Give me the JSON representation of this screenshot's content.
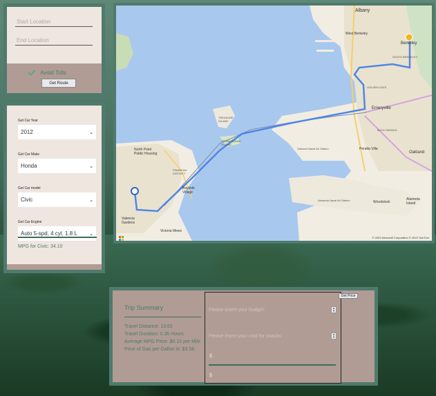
{
  "route": {
    "start_placeholder": "Start Location",
    "end_placeholder": "End Location",
    "avoid_tolls_label": "Avoid Tolls",
    "avoid_tolls_checked": true,
    "get_route_label": "Get Route"
  },
  "car": {
    "year_label": "Get Car Year",
    "year_value": "2012",
    "make_label": "Get Car Make",
    "make_value": "Honda",
    "model_label": "Get Car model",
    "model_value": "Civic",
    "engine_label": "Get Car Engine",
    "engine_value": "Auto 5-spd, 4 cyl, 1.8 L",
    "mpg_text": "MPG for Civic: 34.10"
  },
  "map": {
    "places": [
      "Albany",
      "West Berkeley",
      "Berkeley",
      "SOUTH BERKELEY",
      "GOLDEN GATE",
      "Emeryville",
      "TREASURE ISLAND",
      "YERBA BUENA ISLAND",
      "MCCLYMONDS",
      "Peralta Villa",
      "Oakland",
      "North Point Public Housing",
      "FINANCIAL DISTRICT",
      "Bayside Village",
      "Valencia Gardens",
      "Victoria Mews",
      "Woodstock",
      "Alameda Island",
      "Oakland Naval Air Station",
      "Alameda Naval Air Station"
    ],
    "credit": "© 2023 Microsoft Corporation © 2023 TomTom",
    "brand": "Microsoft"
  },
  "trip": {
    "title": "Trip Summary",
    "distance": "Travel Distance: 13.62",
    "duration": "Travel Duration: 0.36 Hours",
    "avg_mpg_price": "Average MPG Price: $0.10 per Mile",
    "gas_price": "Price of Gas per Gallon is: $3.58",
    "budget_placeholder": "Please insert your budget:",
    "snacks_placeholder": "Please insert your cost for snacks:",
    "dollar1": "$",
    "dollar2": "$",
    "get_price_label": "Get Price"
  },
  "colors": {
    "panel_border": "#4f7a6d",
    "panel_light": "#efe6df",
    "panel_dark": "#b09c94",
    "water": "#a9c8ee",
    "route": "#4f86e6"
  }
}
